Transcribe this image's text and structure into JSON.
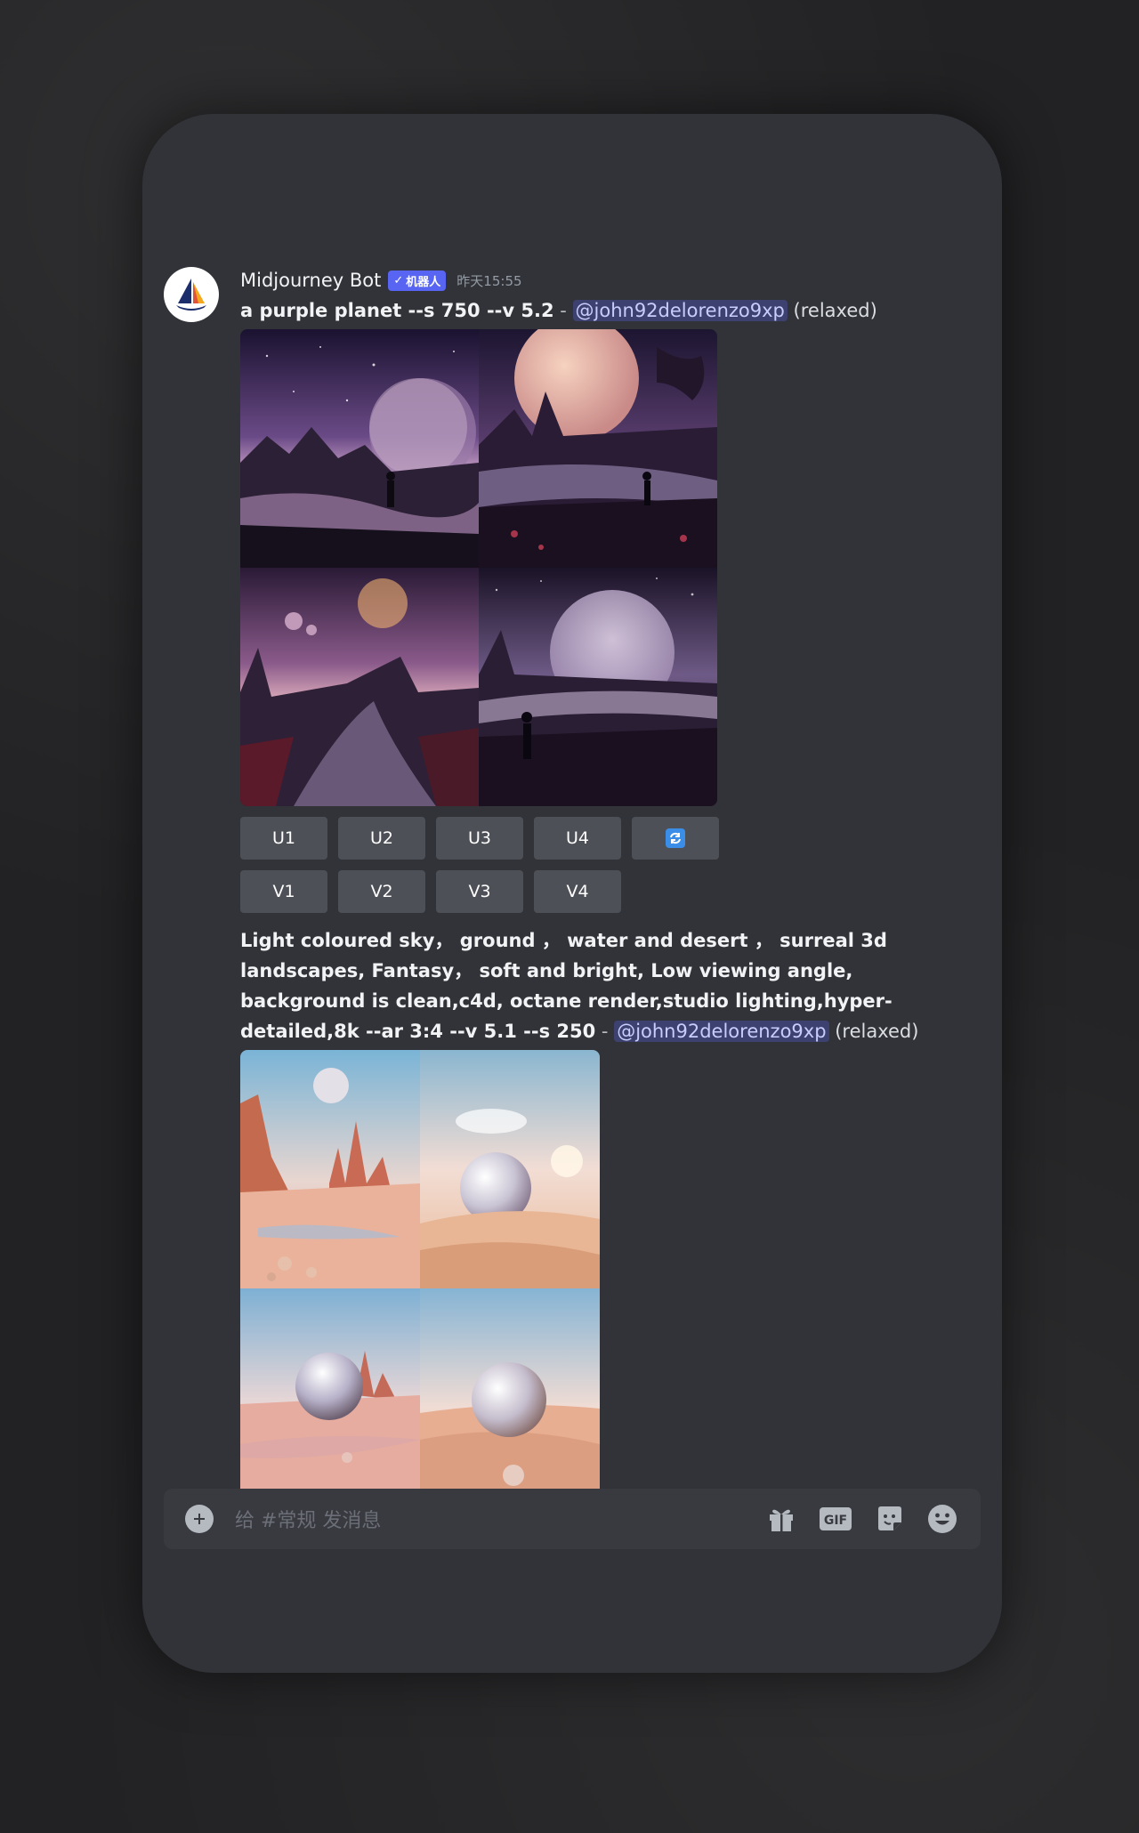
{
  "message": {
    "username": "Midjourney Bot",
    "bot_tag": "机器人",
    "timestamp": "昨天15:55"
  },
  "post1": {
    "prompt_bold": "a purple planet --s 750 --v 5.2",
    "separator": " - ",
    "mention": "@john92delorenzo9xp",
    "suffix": " (relaxed)",
    "upscale_buttons": [
      "U1",
      "U2",
      "U3",
      "U4"
    ],
    "variation_buttons": [
      "V1",
      "V2",
      "V3",
      "V4"
    ]
  },
  "post2": {
    "prompt_line1": "Light coloured sky， ground ， water and desert ， surreal 3d",
    "prompt_line2": "landscapes, Fantasy， soft and bright, Low viewing angle,",
    "prompt_line3": "background is clean,c4d, octane render,studio lighting,hyper-",
    "prompt_line4": "detailed,8k --ar 3:4 --v 5.1 --s 250",
    "separator": " - ",
    "mention": "@john92delorenzo9xp",
    "suffix": " (relaxed)"
  },
  "input": {
    "placeholder": "给 #常规 发消息"
  },
  "icons": {
    "avatar": "midjourney-sailboat-icon",
    "refresh": "refresh-icon",
    "plus": "plus-icon",
    "gift": "gift-icon",
    "gif": "gif-icon",
    "sticker": "sticker-icon",
    "emoji": "emoji-icon"
  },
  "colors": {
    "background": "#313338",
    "blurple": "#5865f2",
    "button": "#4e5058",
    "input": "#383a40"
  }
}
